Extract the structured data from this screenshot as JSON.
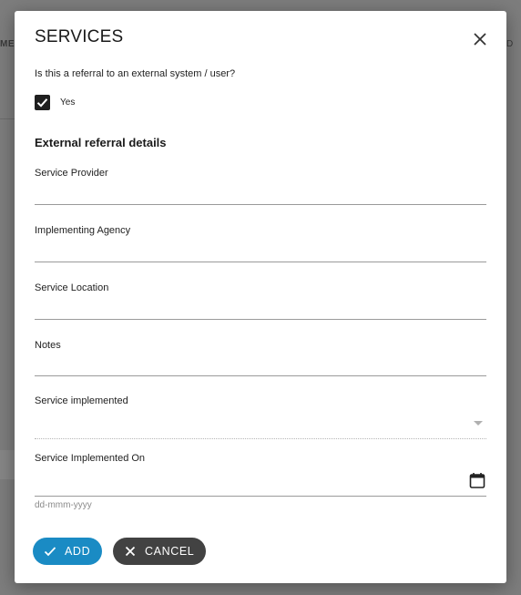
{
  "background": {
    "left_text": "ME",
    "right_text": "D"
  },
  "dialog": {
    "title": "SERVICES",
    "close_icon": "close-icon",
    "question": "Is this a referral to an external system / user?",
    "checkbox": {
      "label": "Yes",
      "checked": true
    },
    "section_heading": "External referral details",
    "fields": {
      "service_provider": {
        "label": "Service Provider",
        "value": ""
      },
      "implementing_agency": {
        "label": "Implementing Agency",
        "value": ""
      },
      "service_location": {
        "label": "Service Location",
        "value": ""
      },
      "notes": {
        "label": "Notes",
        "value": ""
      },
      "service_implemented": {
        "label": "Service implemented",
        "value": ""
      },
      "service_implemented_on": {
        "label": "Service Implemented On",
        "value": "",
        "hint": "dd-mmm-yyyy"
      }
    },
    "buttons": {
      "add": "ADD",
      "cancel": "CANCEL"
    }
  },
  "colors": {
    "primary": "#1a8bc4",
    "secondary": "#424242",
    "overlay": "#7f7f7f"
  }
}
